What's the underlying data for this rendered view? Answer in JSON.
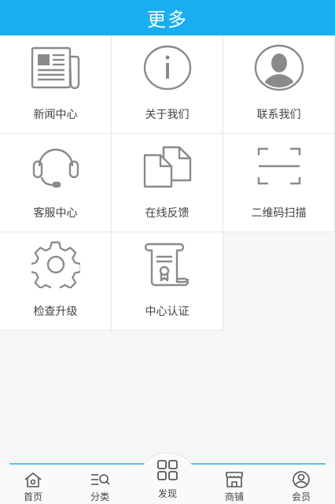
{
  "header": {
    "title": "更多"
  },
  "grid": {
    "items": [
      {
        "label": "新闻中心",
        "icon": "newspaper-icon"
      },
      {
        "label": "关于我们",
        "icon": "info-icon"
      },
      {
        "label": "联系我们",
        "icon": "contact-person-icon"
      },
      {
        "label": "客服中心",
        "icon": "headset-icon"
      },
      {
        "label": "在线反馈",
        "icon": "documents-icon"
      },
      {
        "label": "二维码扫描",
        "icon": "scan-frame-icon"
      },
      {
        "label": "检查升级",
        "icon": "gear-icon"
      },
      {
        "label": "中心认证",
        "icon": "certificate-scroll-icon"
      }
    ]
  },
  "tabbar": {
    "items": [
      {
        "label": "首页",
        "icon": "home-icon"
      },
      {
        "label": "分类",
        "icon": "category-search-icon"
      },
      {
        "label": "发现",
        "icon": "grid-four-icon"
      },
      {
        "label": "商铺",
        "icon": "shop-icon"
      },
      {
        "label": "会员",
        "icon": "member-icon"
      }
    ]
  },
  "colors": {
    "header_bg": "#1aaef0",
    "icon_gray": "#8a8a8a",
    "tab_line": "#4fc3f2"
  }
}
